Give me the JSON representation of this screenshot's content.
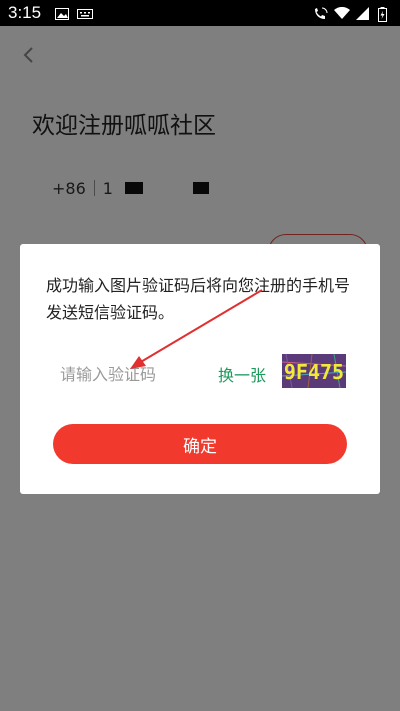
{
  "status_bar": {
    "time": "3:15",
    "icons": [
      "image-icon",
      "keyboard-icon",
      "wifi-calling-icon",
      "wifi-icon",
      "signal-icon",
      "battery-icon"
    ]
  },
  "page": {
    "title": "欢迎注册呱呱社区",
    "phone": {
      "country_code": "+86",
      "value_visible": "1"
    }
  },
  "dialog": {
    "message": "成功输入图片验证码后将向您注册的手机号发送短信验证码。",
    "captcha_input": {
      "placeholder": "请输入验证码",
      "value": ""
    },
    "refresh_label": "换一张",
    "captcha_image_text": "9F475",
    "confirm_label": "确定"
  },
  "colors": {
    "accent_red": "#f2392e",
    "link_green": "#1a9a5b",
    "captcha_bg": "#5b3a7a",
    "captcha_text": "#f2e838",
    "overlay": "rgba(0,0,0,0.5)"
  }
}
